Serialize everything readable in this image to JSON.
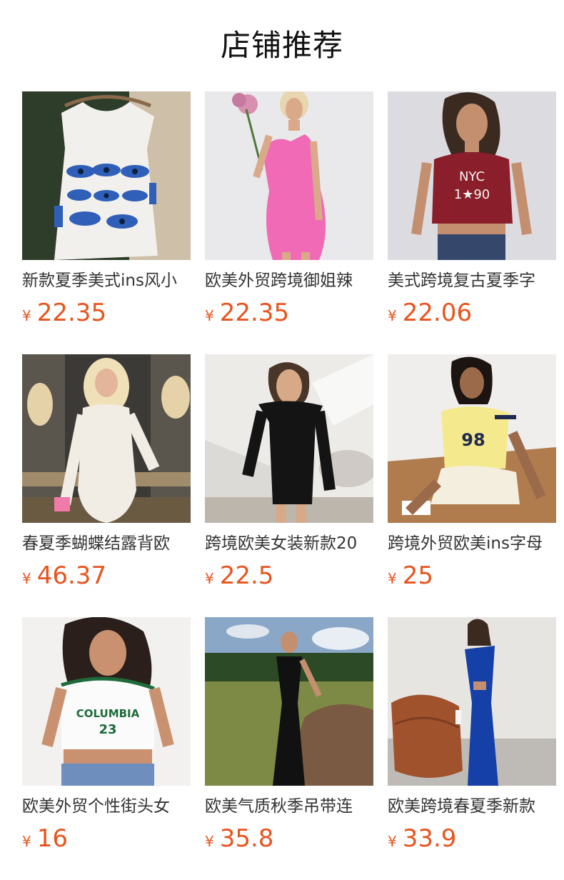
{
  "header": {
    "title": "店铺推荐"
  },
  "products": [
    {
      "name": "新款夏季美式ins风小",
      "currency": "¥",
      "price": "22.35",
      "image": "white-eye-print-tank-top-image"
    },
    {
      "name": "欧美外贸跨境御姐辣",
      "currency": "¥",
      "price": "22.35",
      "image": "pink-halter-dress-image"
    },
    {
      "name": "美式跨境复古夏季字",
      "currency": "¥",
      "price": "22.06",
      "image": "red-nyc-tee-image"
    },
    {
      "name": "春夏季蝴蝶结露背欧",
      "currency": "¥",
      "price": "46.37",
      "image": "white-long-sleeve-dress-image"
    },
    {
      "name": "跨境欧美女装新款20",
      "currency": "¥",
      "price": "22.5",
      "image": "black-off-shoulder-dress-image"
    },
    {
      "name": "跨境外贸欧美ins字母",
      "currency": "¥",
      "price": "25",
      "image": "yellow-98-tee-image"
    },
    {
      "name": "欧美外贸个性街头女",
      "currency": "¥",
      "price": "16",
      "image": "columbia-23-crop-top-image"
    },
    {
      "name": "欧美气质秋季吊带连",
      "currency": "¥",
      "price": "35.8",
      "image": "black-halter-maxi-dress-image"
    },
    {
      "name": "欧美跨境春夏季新款",
      "currency": "¥",
      "price": "33.9",
      "image": "blue-one-shoulder-dress-image"
    }
  ],
  "colors": {
    "price": "#e8541e",
    "title": "#111111",
    "text": "#333333"
  }
}
